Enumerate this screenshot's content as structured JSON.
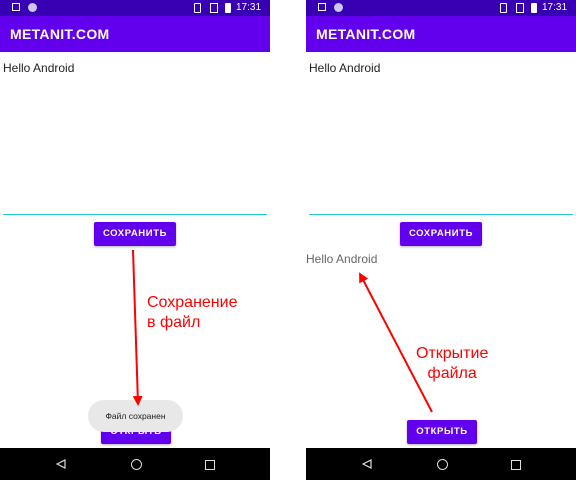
{
  "status_bar": {
    "time": "17:31"
  },
  "app": {
    "title": "METANIT.COM"
  },
  "left_screen": {
    "editor_text": "Hello Android",
    "save_button": "СОХРАНИТЬ",
    "open_button": "ОТКРЫТЬ",
    "toast": "Файл сохранен"
  },
  "right_screen": {
    "editor_text": "Hello Android",
    "save_button": "СОХРАНИТЬ",
    "output_text": "Hello Android",
    "open_button": "ОТКРЫТЬ"
  },
  "annotations": {
    "save_line1": "Сохранение",
    "save_line2": "в файл",
    "open_line1": "Открытие",
    "open_line2": "файла"
  },
  "colors": {
    "status_bar": "#3700b3",
    "app_bar": "#6200ee",
    "button": "#6200ee",
    "editor_underline": "#26c6da",
    "annotation": "#ff0000"
  },
  "icons": {
    "nav_back": "back-triangle-icon",
    "nav_home": "home-circle-icon",
    "nav_recent": "recents-square-icon"
  }
}
